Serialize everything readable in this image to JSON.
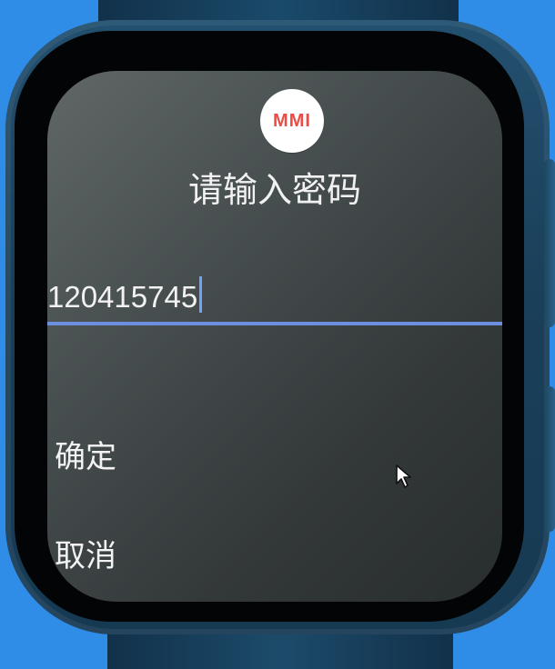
{
  "app": {
    "logo_text": "MMI",
    "title": "请输入密码"
  },
  "password": {
    "value": "120415745"
  },
  "actions": {
    "confirm": "确定",
    "cancel": "取消"
  },
  "icons": {
    "logo": "mmi-logo-icon",
    "cursor": "mouse-pointer-icon"
  },
  "colors": {
    "background": "#2f8de8",
    "screen": "#4b5252",
    "text": "#f2f2f2",
    "accent": "#6d8fe0",
    "logo": "#ef4a43"
  }
}
